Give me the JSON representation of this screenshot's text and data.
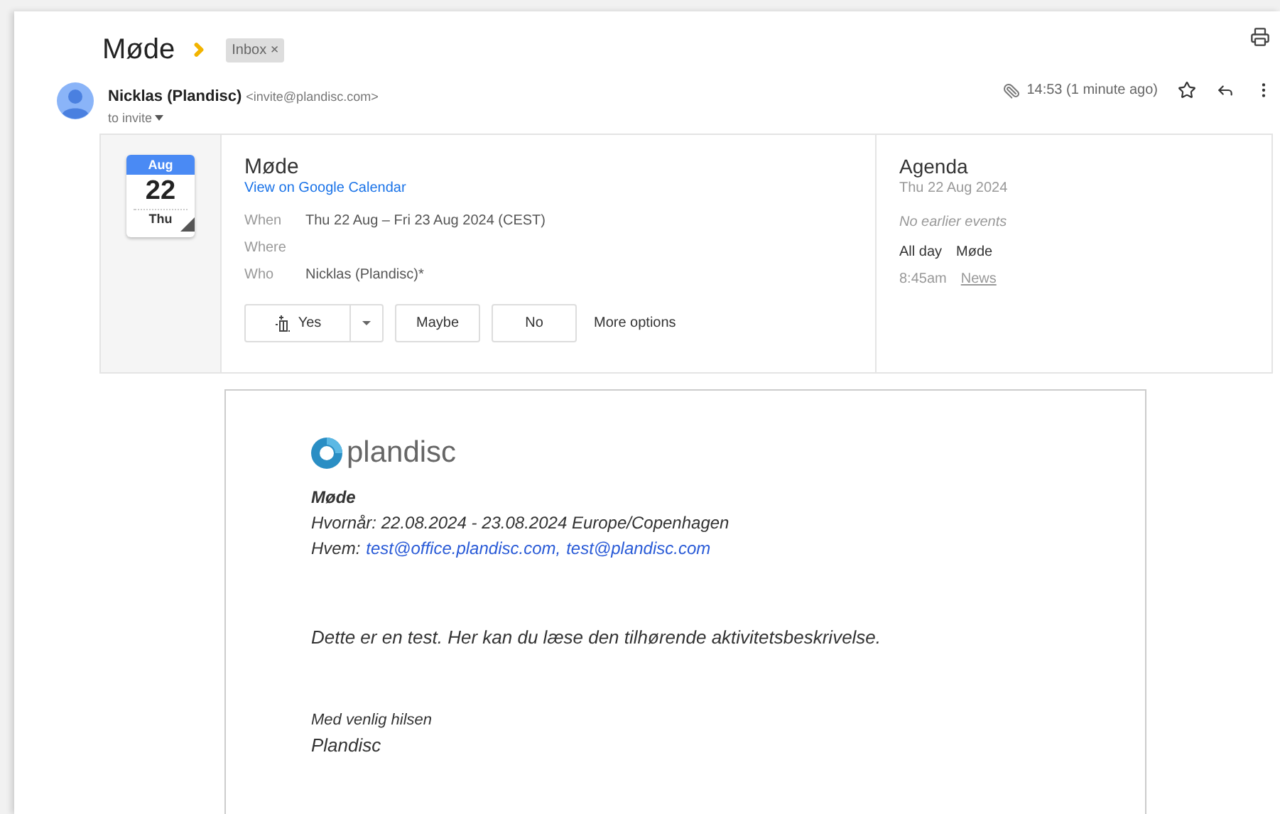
{
  "subject": "Møde",
  "label_chip": "Inbox ×",
  "sender": {
    "name": "Nicklas (Plandisc)",
    "email": "<invite@plandisc.com>",
    "to": "to invite"
  },
  "time": "14:53 (1 minute ago)",
  "invite": {
    "month": "Aug",
    "day": "22",
    "weekday": "Thu",
    "title": "Møde",
    "calendar_link": "View on Google Calendar",
    "details": [
      {
        "label": "When",
        "value": "Thu 22 Aug – Fri 23 Aug 2024 (CEST)"
      },
      {
        "label": "Where"
      },
      {
        "label": "Who",
        "value": "Nicklas (Plandisc)*"
      }
    ],
    "rsvp": [
      {
        "kind": "split",
        "label": "Yes"
      },
      {
        "kind": "plain",
        "label": "Maybe"
      },
      {
        "kind": "plain",
        "label": "No"
      },
      {
        "kind": "link",
        "label": "More options"
      }
    ]
  },
  "agenda": {
    "title": "Agenda",
    "date": "Thu 22 Aug 2024",
    "note": "No earlier events",
    "events": [
      {
        "time": "All day",
        "name": "Møde",
        "muted": false
      },
      {
        "time": "8:45am",
        "name": "News",
        "muted": true
      }
    ]
  },
  "body": {
    "logo_text": "plandisc",
    "title": "Møde",
    "when": "Hvornår: 22.08.2024 - 23.08.2024 Europe/Copenhagen",
    "who_label": "Hvem:",
    "who_links": [
      "test@office.plandisc.com,",
      "test@plandisc.com"
    ],
    "message": "Dette er en test. Her kan du læse den tilhørende aktivitetsbeskrivelse.",
    "closing": "Med venlig hilsen",
    "signature": "Plandisc"
  }
}
